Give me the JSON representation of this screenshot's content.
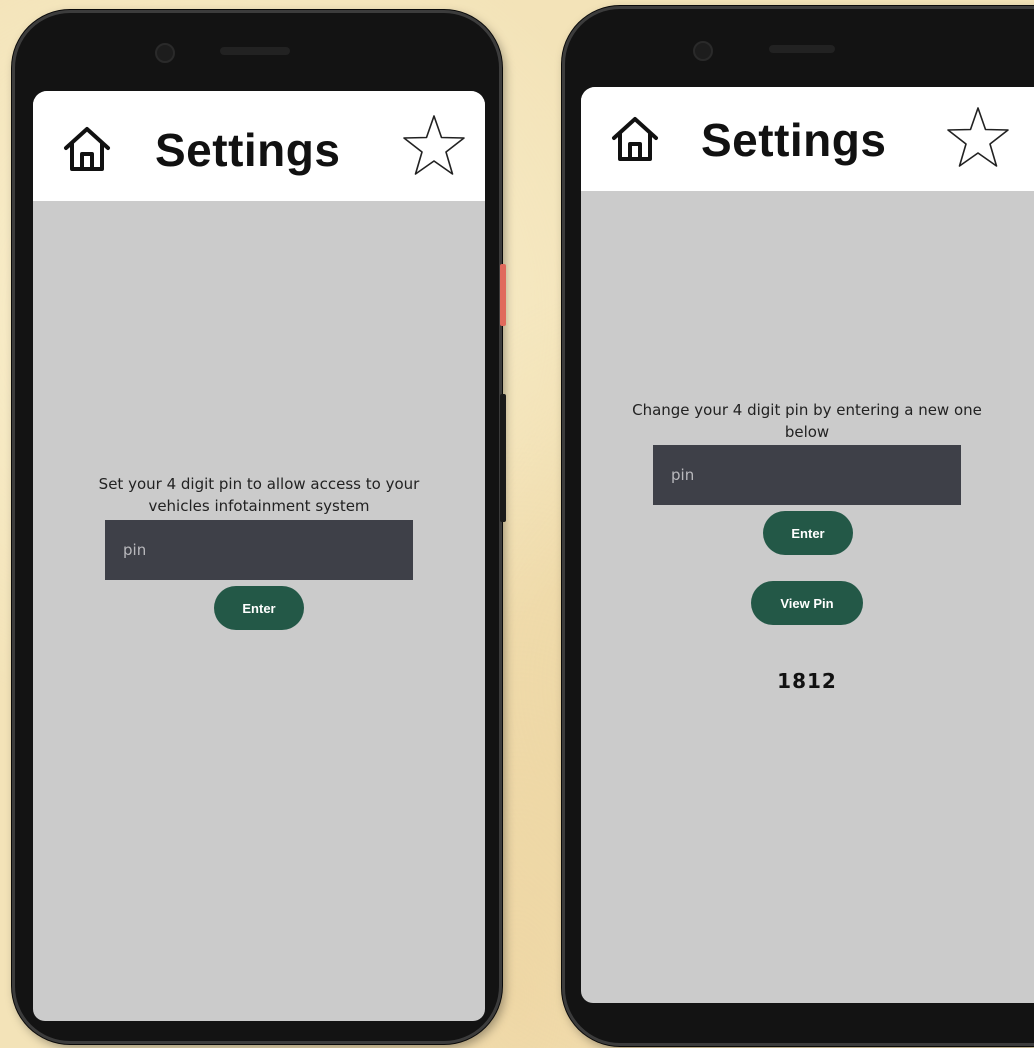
{
  "phones": [
    {
      "header": {
        "title": "Settings",
        "home_icon": "home-icon",
        "star_icon": "star-icon"
      },
      "prompt": "Set your 4 digit pin to allow access to your vehicles infotainment system",
      "pin_input": {
        "value": "",
        "placeholder": "pin"
      },
      "enter_label": "Enter"
    },
    {
      "header": {
        "title": "Settings",
        "home_icon": "home-icon",
        "star_icon": "star-icon"
      },
      "prompt": "Change your 4 digit pin by entering a new one below",
      "pin_input": {
        "value": "",
        "placeholder": "pin"
      },
      "enter_label": "Enter",
      "view_pin_label": "View Pin",
      "pin_value": "1812"
    }
  ],
  "colors": {
    "background": "#f3e3b8",
    "screen": "#cbcbcb",
    "header": "#ffffff",
    "input": "#3e4048",
    "button": "#235847",
    "power_button": "#e06a5c"
  }
}
